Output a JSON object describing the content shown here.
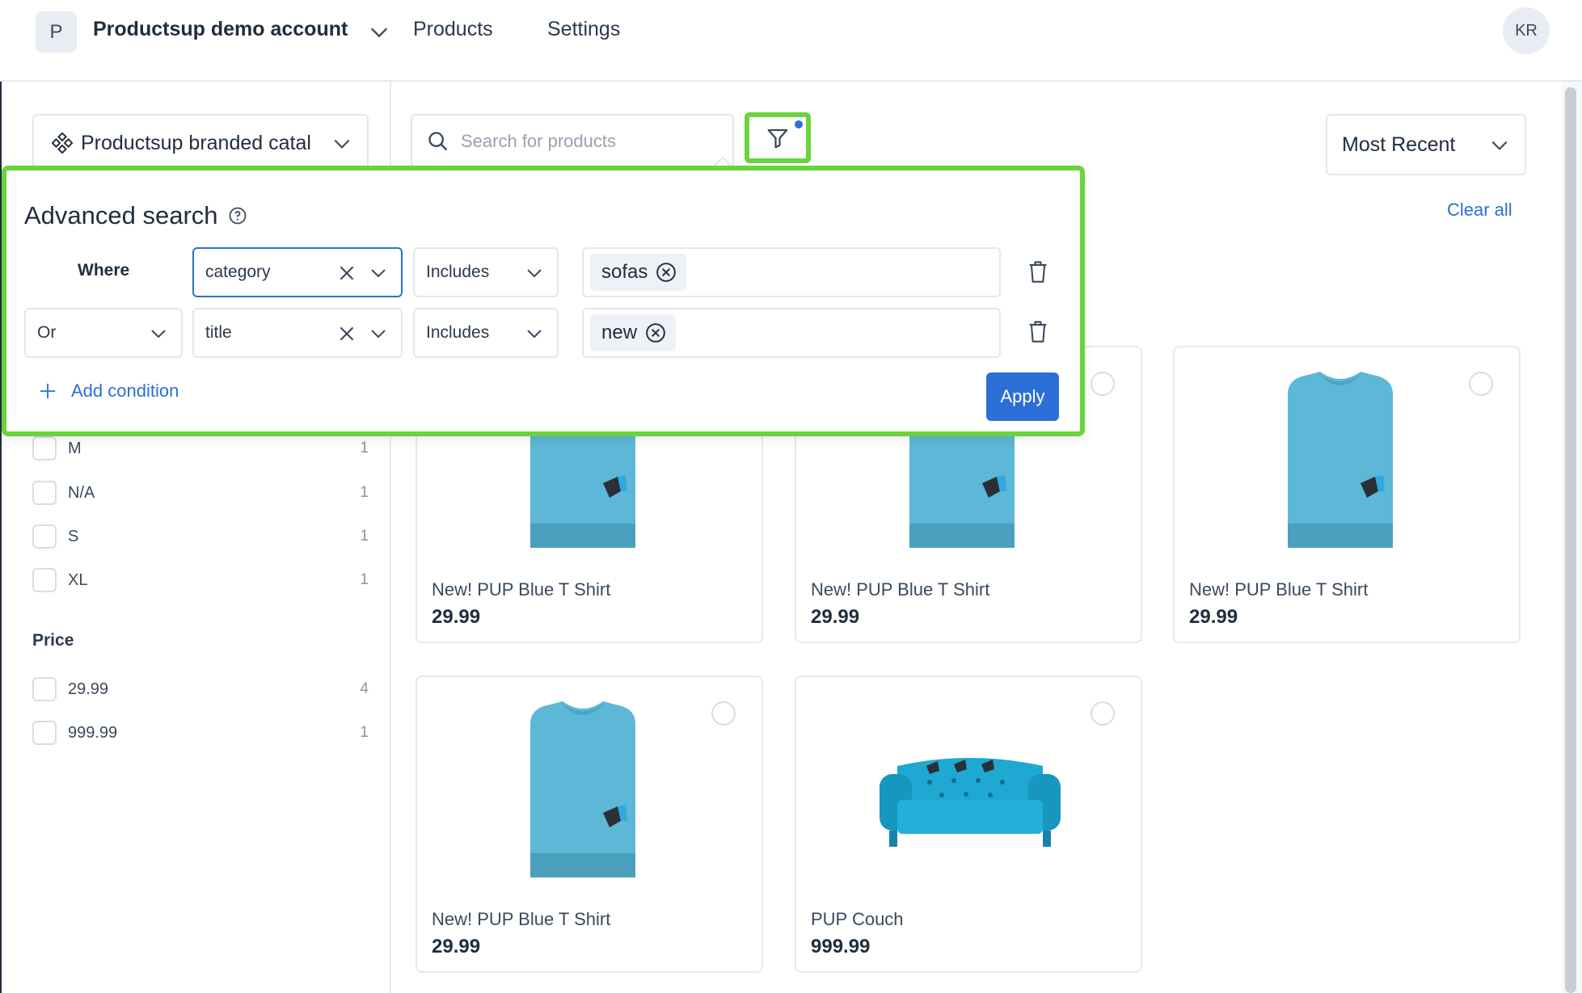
{
  "header": {
    "account_initial": "P",
    "account_name": "Productsup demo account",
    "nav": [
      "Products",
      "Settings"
    ],
    "user_initials": "KR"
  },
  "sidebar": {
    "catalog": "Productsup branded catal",
    "size_facets": [
      {
        "label": "M",
        "count": "1"
      },
      {
        "label": "N/A",
        "count": "1"
      },
      {
        "label": "S",
        "count": "1"
      },
      {
        "label": "XL",
        "count": "1"
      }
    ],
    "price_title": "Price",
    "price_facets": [
      {
        "label": "29.99",
        "count": "4"
      },
      {
        "label": "999.99",
        "count": "1"
      }
    ]
  },
  "toolbar": {
    "search_placeholder": "Search for products",
    "sort": "Most Recent",
    "clear_all": "Clear all"
  },
  "advanced_search": {
    "title": "Advanced search",
    "where_label": "Where",
    "conditions": [
      {
        "field": "category",
        "operator": "Includes",
        "values": [
          "sofas"
        ]
      },
      {
        "connector": "Or",
        "field": "title",
        "operator": "Includes",
        "values": [
          "new"
        ]
      }
    ],
    "add_condition": "Add condition",
    "apply": "Apply"
  },
  "products": [
    {
      "title": "New! PUP Blue T Shirt",
      "price": "29.99",
      "kind": "tshirt"
    },
    {
      "title": "New! PUP Blue T Shirt",
      "price": "29.99",
      "kind": "tshirt"
    },
    {
      "title": "New! PUP Blue T Shirt",
      "price": "29.99",
      "kind": "tshirt"
    },
    {
      "title": "New! PUP Blue T Shirt",
      "price": "29.99",
      "kind": "tshirt"
    },
    {
      "title": "PUP Couch",
      "price": "999.99",
      "kind": "couch"
    }
  ],
  "colors": {
    "accent": "#2c6fd6",
    "highlight": "#6ad43c",
    "product_blue": "#5cb8d6"
  }
}
